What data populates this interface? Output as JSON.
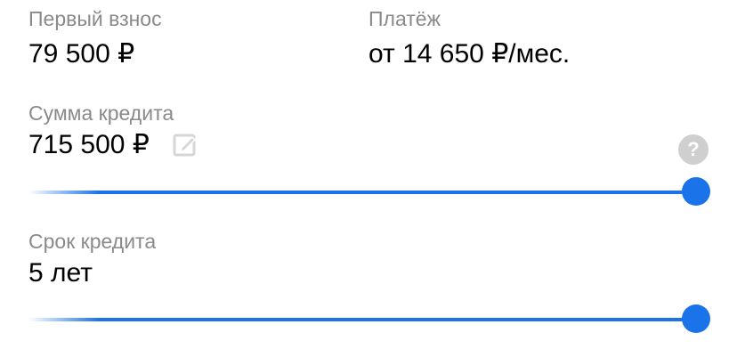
{
  "down_payment": {
    "label": "Первый взнос",
    "value": "79 500 ₽"
  },
  "payment": {
    "label": "Платёж",
    "value": "от 14 650 ₽/мес."
  },
  "loan_amount": {
    "label": "Сумма кредита",
    "value": "715 500 ₽",
    "edit_icon": "pencil-edit-icon",
    "help_icon": "question-icon",
    "help_glyph": "?",
    "slider_fraction": 1.0
  },
  "loan_term": {
    "label": "Срок кредита",
    "value": "5 лет",
    "slider_fraction": 1.0
  },
  "colors": {
    "accent": "#1a73e8",
    "label": "#8a8a8a",
    "icon_muted": "#cfcfcf"
  }
}
